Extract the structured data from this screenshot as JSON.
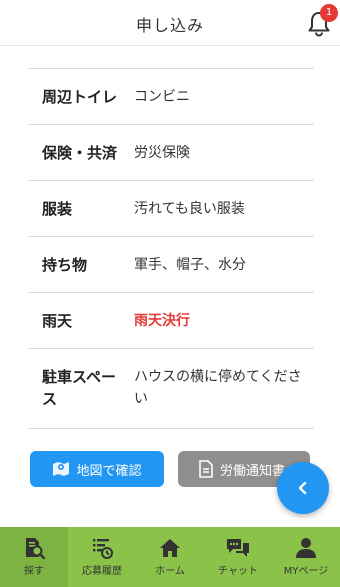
{
  "header": {
    "title": "申し込み",
    "notification_count": "1"
  },
  "details": [
    {
      "label": "周辺トイレ",
      "value": "コンビニ",
      "highlight": false
    },
    {
      "label": "保険・共済",
      "value": "労災保険",
      "highlight": false
    },
    {
      "label": "服装",
      "value": "汚れても良い服装",
      "highlight": false
    },
    {
      "label": "持ち物",
      "value": "軍手、帽子、水分",
      "highlight": false
    },
    {
      "label": "雨天",
      "value": "雨天決行",
      "highlight": true
    },
    {
      "label": "駐車スペース",
      "value": "ハウスの横に停めてください",
      "highlight": false
    }
  ],
  "buttons": {
    "map_label": "地図で確認",
    "notice_label": "労働通知書"
  },
  "bottom_nav": [
    {
      "label": "探す",
      "icon": "search-document-icon",
      "active": true
    },
    {
      "label": "応募履歴",
      "icon": "history-list-icon",
      "active": false
    },
    {
      "label": "ホーム",
      "icon": "home-icon",
      "active": false
    },
    {
      "label": "チャット",
      "icon": "chat-icon",
      "active": false
    },
    {
      "label": "MYページ",
      "icon": "person-icon",
      "active": false
    }
  ],
  "colors": {
    "accent": "#2196f3",
    "nav_background": "#8bc34a",
    "highlight_text": "#e53935",
    "secondary_button": "#8f8f8f"
  }
}
